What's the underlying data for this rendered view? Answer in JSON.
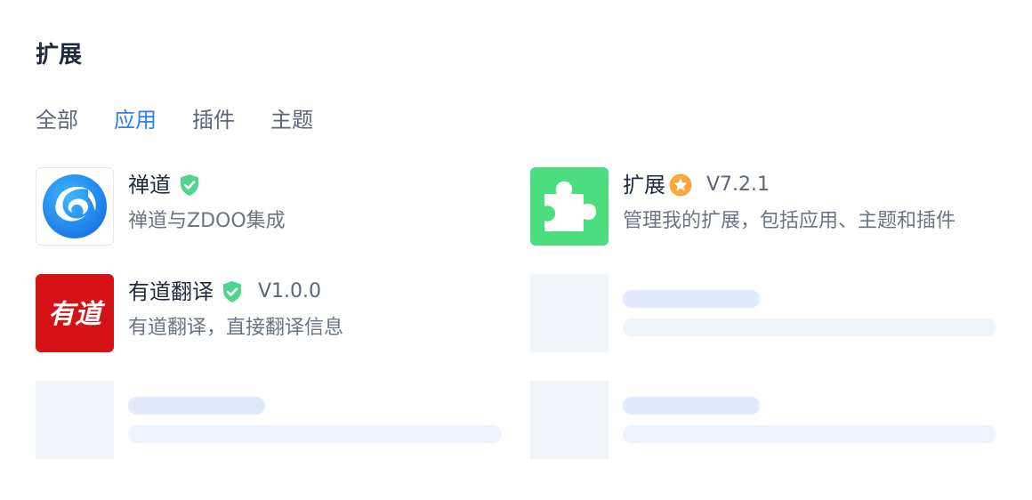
{
  "page": {
    "title": "扩展"
  },
  "tabs": [
    {
      "label": "全部",
      "active": false
    },
    {
      "label": "应用",
      "active": true
    },
    {
      "label": "插件",
      "active": false
    },
    {
      "label": "主题",
      "active": false
    }
  ],
  "extensions": [
    {
      "name": "禅道",
      "badge": "verified-shield",
      "version": "",
      "description": "禅道与ZDOO集成",
      "icon": "zentao-logo"
    },
    {
      "name": "扩展",
      "badge": "star-badge",
      "version": "V7.2.1",
      "description": "管理我的扩展，包括应用、主题和插件",
      "icon": "puzzle-icon"
    },
    {
      "name": "有道翻译",
      "badge": "verified-shield",
      "version": "V1.0.0",
      "description": "有道翻译，直接翻译信息",
      "icon": "youdao-logo",
      "icon_text": "有道"
    }
  ],
  "colors": {
    "accent": "#2b80ff",
    "verified": "#4fd68c",
    "star": "#f7a93b",
    "puzzle_bg": "#4cde7e",
    "youdao_bg": "#d51216",
    "skeleton": "#f1f4f8"
  }
}
